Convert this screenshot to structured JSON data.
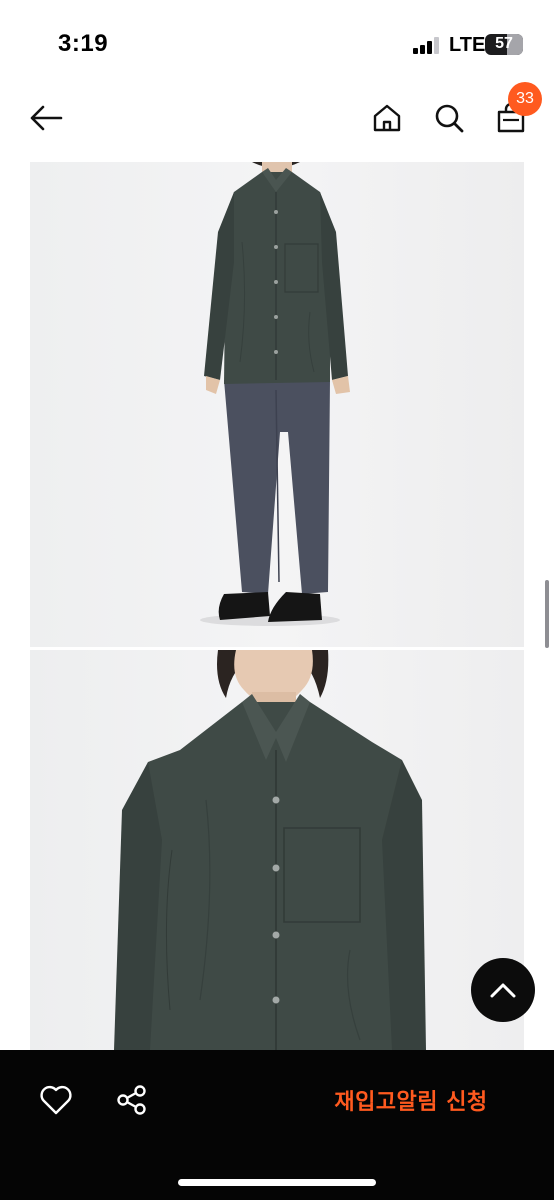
{
  "status_bar": {
    "time": "3:19",
    "network": "LTE",
    "battery": "57",
    "battery_level": 0.57
  },
  "header": {
    "back_icon": "arrow-left-icon",
    "home_icon": "home-icon",
    "search_icon": "search-icon",
    "bag_icon": "shopping-bag-icon",
    "cart_count": "33"
  },
  "images": [
    {
      "name": "product-photo-full-body",
      "alt": ""
    },
    {
      "name": "product-photo-closeup",
      "alt": ""
    }
  ],
  "scroll_top_icon": "chevron-up-icon",
  "bottom_bar": {
    "like_icon": "heart-icon",
    "share_icon": "share-icon",
    "restock_label": "재입고알림 신청"
  },
  "colors": {
    "accent": "#ff5a1f",
    "bar_background": "#050505",
    "shirt": "#3f4a46",
    "pants": "#4a4f5e"
  }
}
